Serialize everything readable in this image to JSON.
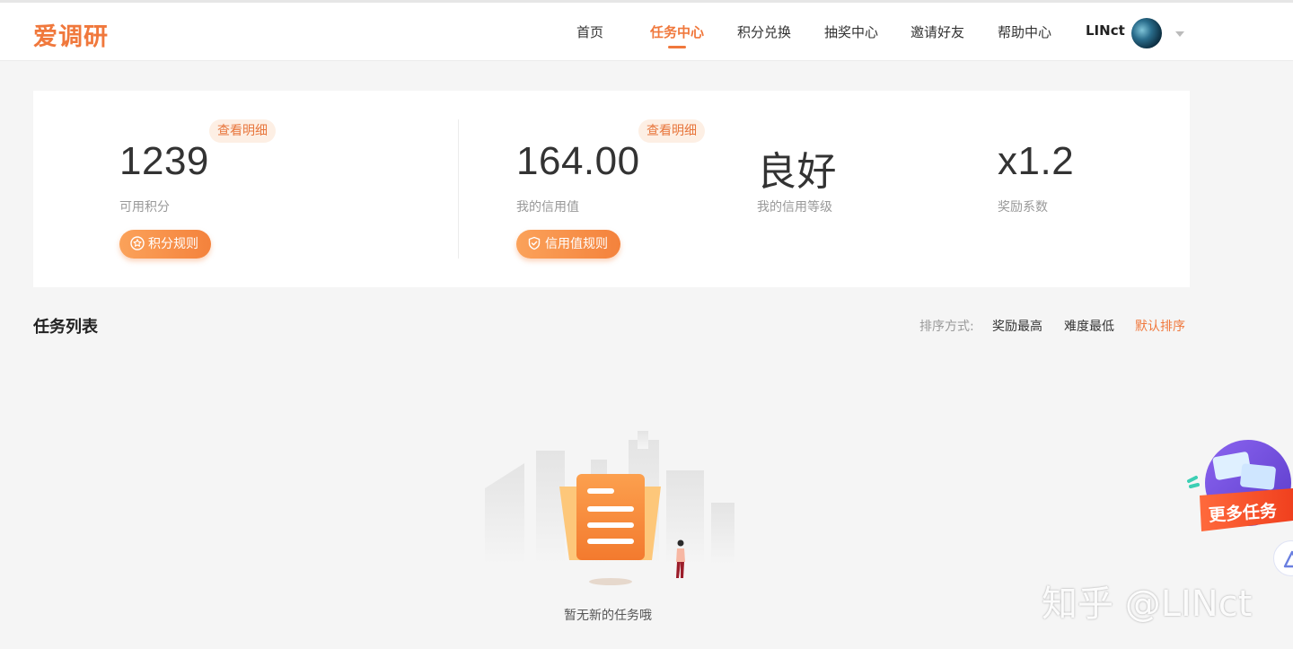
{
  "app": {
    "logo": "爱调研"
  },
  "nav": {
    "items": [
      {
        "label": "首页"
      },
      {
        "label": "任务中心",
        "active": true
      },
      {
        "label": "积分兑换"
      },
      {
        "label": "抽奖中心"
      },
      {
        "label": "邀请好友"
      },
      {
        "label": "帮助中心"
      }
    ],
    "username": "LINct"
  },
  "stats": {
    "points": {
      "value": "1239",
      "label": "可用积分",
      "detail": "查看明细",
      "rule_button": "积分规则"
    },
    "credit": {
      "value": "164.00",
      "label": "我的信用值",
      "detail": "查看明细",
      "rule_button": "信用值规则"
    },
    "level": {
      "value": "良好",
      "label": "我的信用等级"
    },
    "multiplier": {
      "value": "x1.2",
      "label": "奖励系数"
    }
  },
  "task_list": {
    "title": "任务列表",
    "sort_label": "排序方式:",
    "sort_options": [
      {
        "label": "奖励最高"
      },
      {
        "label": "难度最低"
      },
      {
        "label": "默认排序",
        "active": true
      }
    ],
    "empty_text": "暂无新的任务哦"
  },
  "float_widget": {
    "label": "更多任务"
  },
  "watermark": "知乎 @LINct",
  "colors": {
    "accent": "#f0783c",
    "button": "#f4823c",
    "tag_bg": "#fdefe4",
    "page_bg": "#f5f5f5"
  }
}
